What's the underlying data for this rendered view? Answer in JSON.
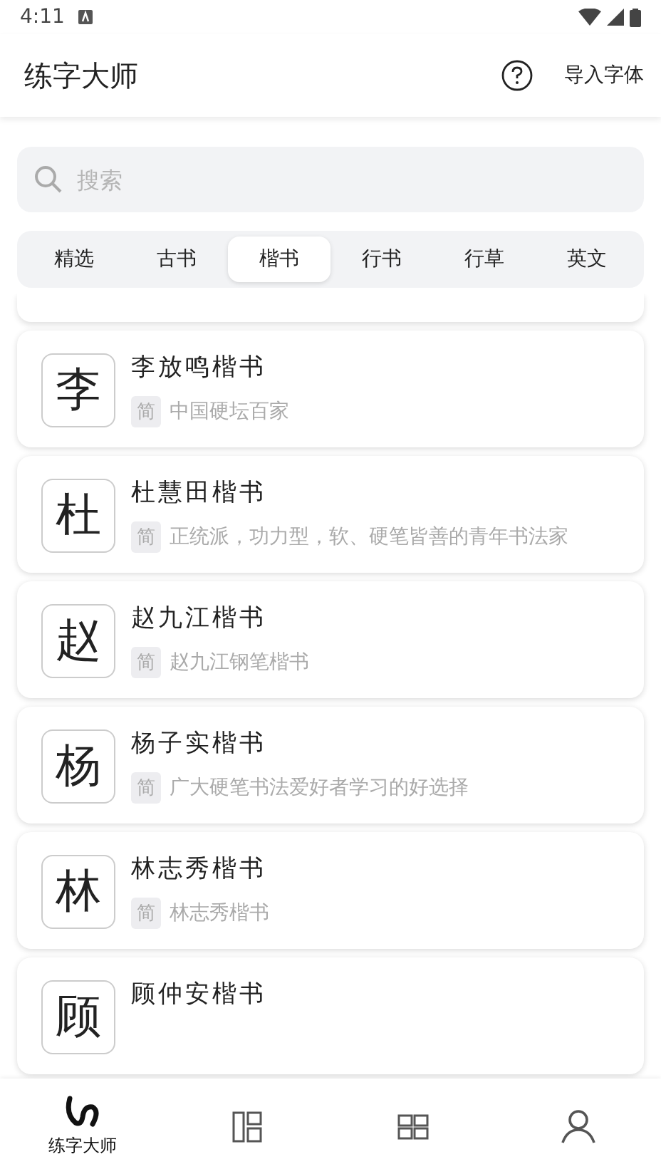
{
  "status_bar": {
    "time": "4:11"
  },
  "app_bar": {
    "title": "练字大师",
    "action": "导入字体"
  },
  "search": {
    "placeholder": "搜索"
  },
  "tabs": [
    {
      "label": "精选",
      "selected": false
    },
    {
      "label": "古书",
      "selected": false
    },
    {
      "label": "楷书",
      "selected": true
    },
    {
      "label": "行书",
      "selected": false
    },
    {
      "label": "行草",
      "selected": false
    },
    {
      "label": "英文",
      "selected": false
    }
  ],
  "fonts": [
    {
      "char": "李",
      "name": "李放鸣楷书",
      "tag": "简",
      "description": "中国硬坛百家"
    },
    {
      "char": "杜",
      "name": "杜慧田楷书",
      "tag": "简",
      "description": "正统派，功力型，软、硬笔皆善的青年书法家"
    },
    {
      "char": "赵",
      "name": "赵九江楷书",
      "tag": "简",
      "description": "赵九江钢笔楷书"
    },
    {
      "char": "杨",
      "name": "杨子实楷书",
      "tag": "简",
      "description": "广大硬笔书法爱好者学习的好选择"
    },
    {
      "char": "林",
      "name": "林志秀楷书",
      "tag": "简",
      "description": "林志秀楷书"
    },
    {
      "char": "顾",
      "name": "顾仲安楷书"
    }
  ],
  "bottom_nav": [
    {
      "kind": "brush",
      "label": "练字大师",
      "selected": true
    },
    {
      "kind": "layout",
      "selected": false
    },
    {
      "kind": "grid",
      "selected": false
    },
    {
      "kind": "user",
      "selected": false
    }
  ]
}
